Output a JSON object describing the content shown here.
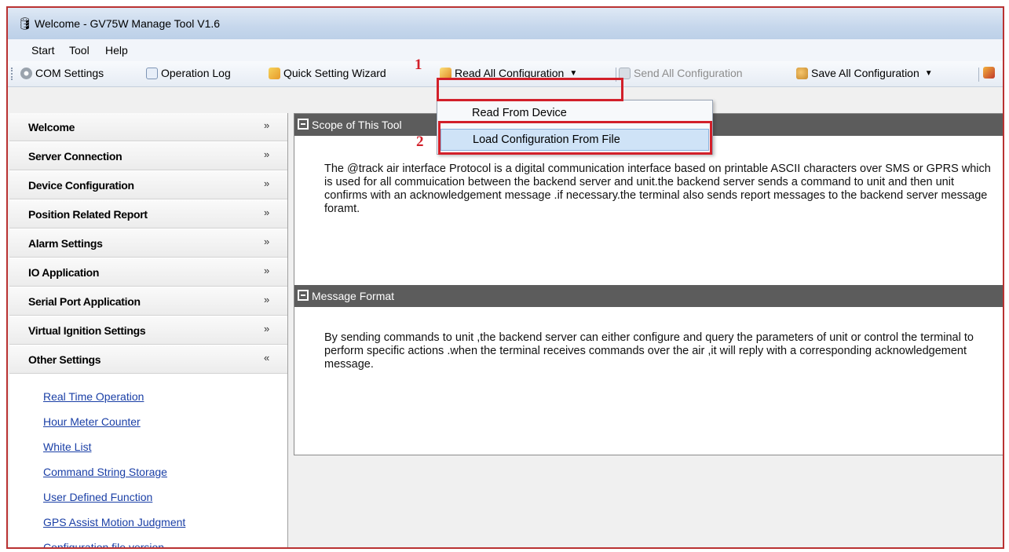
{
  "window": {
    "title": "Welcome - GV75W Manage Tool V1.6"
  },
  "menu": [
    "Start",
    "Tool",
    "Help"
  ],
  "toolbar": {
    "com_settings": "COM Settings",
    "operation_log": "Operation Log",
    "quick_setting_wizard": "Quick Setting Wizard",
    "read_all": "Read All Configuration",
    "send_all": "Send All Configuration",
    "save_all": "Save All Configuration"
  },
  "dropdown": {
    "items": [
      "Read From Device",
      "Load Configuration From File"
    ]
  },
  "annotations": {
    "step1": "1",
    "step2": "2"
  },
  "sidebar": {
    "sections": [
      "Welcome",
      "Server Connection",
      "Device Configuration",
      "Position Related Report",
      "Alarm Settings",
      "IO Application",
      "Serial Port Application",
      "Virtual Ignition Settings",
      "Other Settings"
    ],
    "links": [
      "Real Time Operation",
      "Hour Meter Counter",
      "White List",
      "Command String Storage",
      "User Defined Function",
      "GPS Assist Motion Judgment",
      "Configuration file version"
    ]
  },
  "panels": [
    {
      "title": "Scope of This Tool",
      "body": "The @track air interface Protocol is a digital communication interface based on printable ASCII characters over SMS or GPRS which is used for all commuication between the backend server and unit.the backend server sends a command to unit and then unit confirms with an acknowledgement message .if necessary.the terminal also sends report messages to the backend server message foramt."
    },
    {
      "title": "Message Format",
      "body": "By sending commands to unit ,the backend server can either configure and query the parameters of unit or control the terminal to perform specific actions .when the terminal receives commands over the air ,it will reply with a corresponding acknowledgement message."
    }
  ],
  "colors": {
    "annotation": "#d2202a",
    "panel_header": "#5c5c5c",
    "link": "#1a3fa6"
  }
}
